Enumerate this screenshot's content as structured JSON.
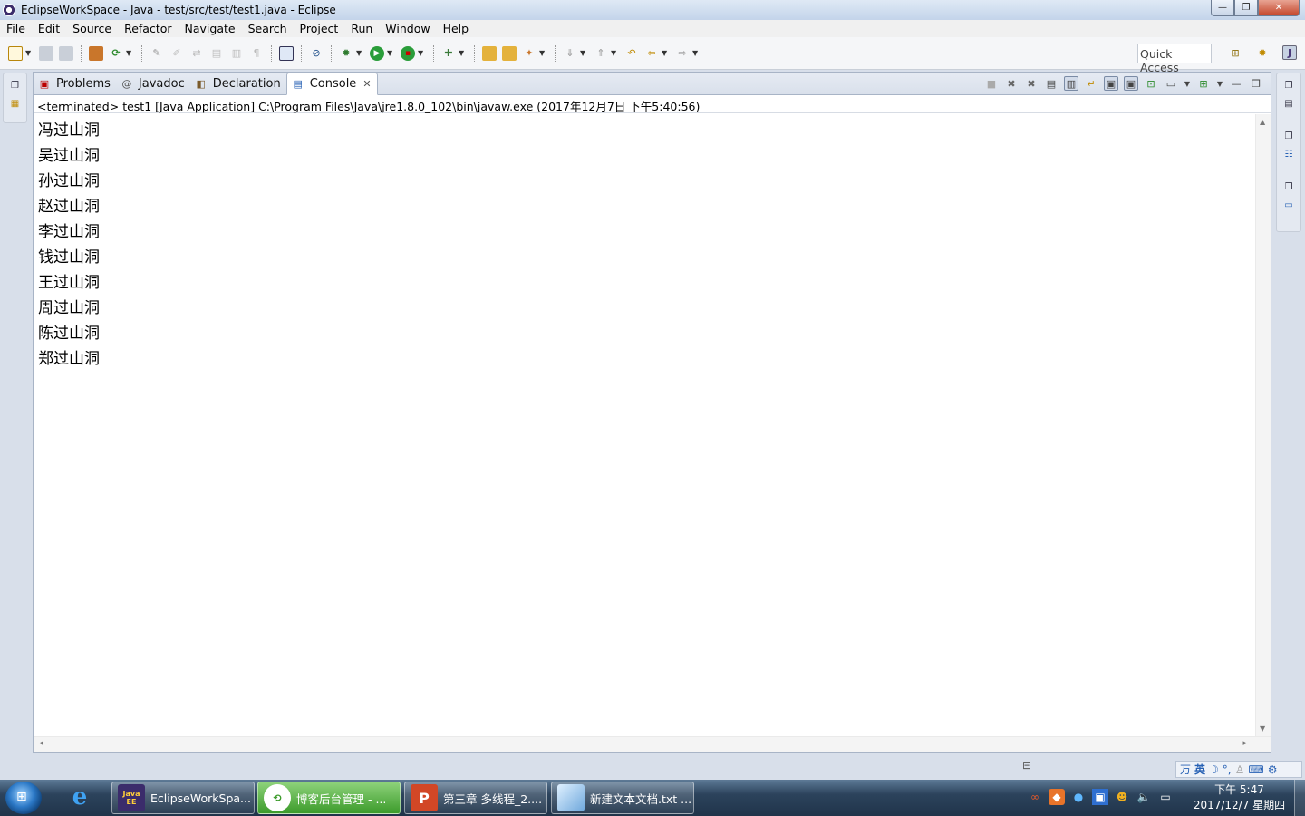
{
  "window": {
    "title": "EclipseWorkSpace - Java - test/src/test/test1.java - Eclipse",
    "controls": {
      "minimize": "—",
      "maximize": "❐",
      "close": "✕"
    }
  },
  "menu": [
    "File",
    "Edit",
    "Source",
    "Refactor",
    "Navigate",
    "Search",
    "Project",
    "Run",
    "Window",
    "Help"
  ],
  "toolbar": {
    "quick_access_placeholder": "Quick Access"
  },
  "view": {
    "tabs": [
      {
        "label": "Problems",
        "icon": "problems-icon",
        "active": false
      },
      {
        "label": "Javadoc",
        "icon": "at-icon",
        "active": false
      },
      {
        "label": "Declaration",
        "icon": "declaration-icon",
        "active": false
      },
      {
        "label": "Console",
        "icon": "console-icon",
        "active": true
      }
    ],
    "tab_icons": {
      "problems": "▣",
      "javadoc": "@",
      "declaration": "◧",
      "console": "▤",
      "close": "✕"
    },
    "console_description": "<terminated> test1 [Java Application] C:\\Program Files\\Java\\jre1.8.0_102\\bin\\javaw.exe (2017年12月7日 下午5:40:56)",
    "console_output": [
      "冯过山洞",
      "吴过山洞",
      "孙过山洞",
      "赵过山洞",
      "李过山洞",
      "钱过山洞",
      "王过山洞",
      "周过山洞",
      "陈过山洞",
      "郑过山洞"
    ]
  },
  "ime": {
    "label": "英"
  },
  "taskbar": {
    "items": [
      {
        "label": "EclipseWorkSpa...",
        "icon": "Java EE"
      },
      {
        "label": "博客后台管理 - ...",
        "icon": ""
      },
      {
        "label": "第三章 多线程_2....",
        "icon": "P"
      },
      {
        "label": "新建文本文档.txt ...",
        "icon": ""
      }
    ],
    "clock": {
      "time": "下午 5:47",
      "date": "2017/12/7 星期四"
    }
  },
  "colors": {
    "accent": "#3c9b2b",
    "title_bar": "#c3d4ea",
    "close_button": "#c4462b",
    "taskbar": "#20344a"
  }
}
